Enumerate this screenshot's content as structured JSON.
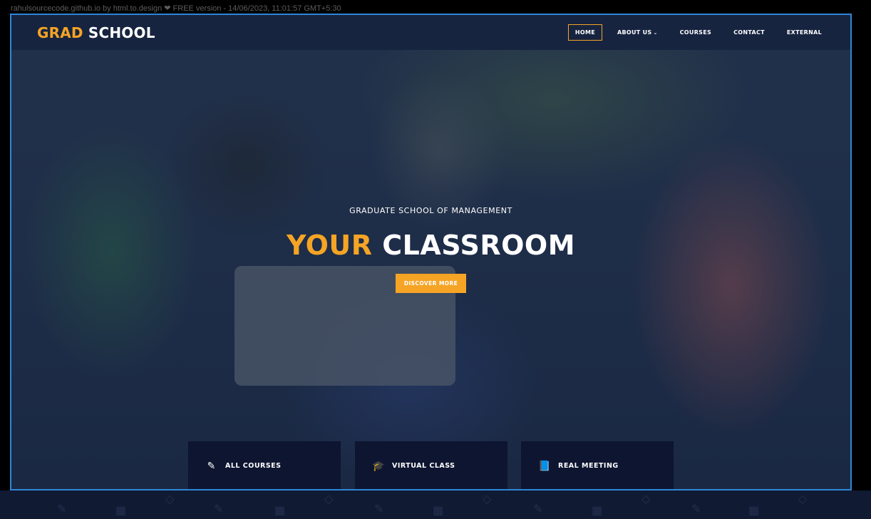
{
  "capture": {
    "caption": "rahulsourcecode.github.io by html.to.design ❤ FREE version - 14/06/2023, 11:01:57 GMT+5:30"
  },
  "header": {
    "logo_accent": "GRAD",
    "logo_rest": "SCHOOL",
    "nav": [
      {
        "label": "HOME",
        "active": true
      },
      {
        "label": "ABOUT US",
        "dropdown": true
      },
      {
        "label": "COURSES"
      },
      {
        "label": "CONTACT"
      },
      {
        "label": "EXTERNAL"
      }
    ]
  },
  "hero": {
    "subtitle": "GRADUATE SCHOOL OF MANAGEMENT",
    "title_accent": "YOUR",
    "title_rest": "CLASSROOM",
    "cta_label": "DISCOVER MORE"
  },
  "features": [
    {
      "label": "ALL COURSES",
      "icon": "pencil-icon",
      "glyph": "✎"
    },
    {
      "label": "VIRTUAL CLASS",
      "icon": "graduation-cap-icon",
      "glyph": "🎓"
    },
    {
      "label": "REAL MEETING",
      "icon": "book-icon",
      "glyph": "📘"
    }
  ],
  "colors": {
    "accent": "#f5a425",
    "navbar": "#172440",
    "feature_bg": "#0d1530"
  }
}
